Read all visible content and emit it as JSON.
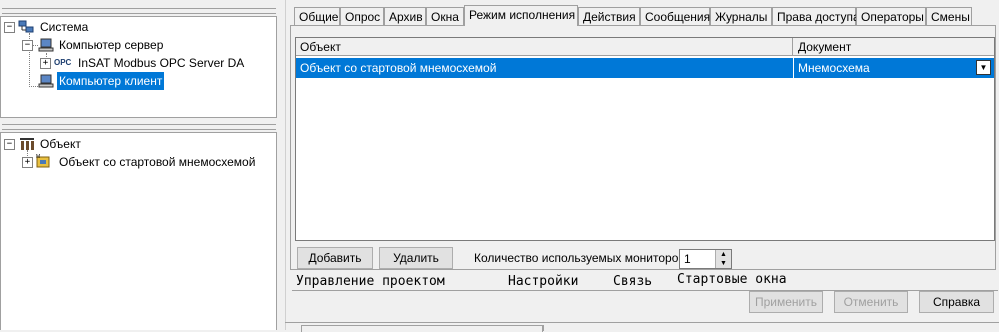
{
  "tree_top": {
    "root": "Система",
    "server": "Компьютер сервер",
    "opc": "InSAT Modbus OPC Server DA",
    "opc_icon_text": "OPC",
    "client": "Компьютер клиент"
  },
  "tree_bottom": {
    "root": "Объект",
    "child": "Объект со стартовой мнемосхемой"
  },
  "tabs": [
    "Общие",
    "Опрос",
    "Архив",
    "Окна",
    "Режим исполнения",
    "Действия",
    "Сообщения",
    "Журналы",
    "Права доступа",
    "Операторы",
    "Смены"
  ],
  "grid": {
    "col_object": "Объект",
    "col_document": "Документ",
    "row_object": "Объект со стартовой мнемосхемой",
    "row_document": "Мнемосхема"
  },
  "controls": {
    "add": "Добавить",
    "delete": "Удалить",
    "monitors_label": "Количество используемых мониторов :",
    "monitors_value": "1"
  },
  "bottom_tabs": [
    "Управление проектом",
    "Настройки",
    "Связь",
    "Стартовые окна"
  ],
  "footer": {
    "apply": "Применить",
    "cancel": "Отменить",
    "help": "Справка"
  },
  "colors": {
    "selection": "#0078d7",
    "window": "#f0f0f0"
  }
}
